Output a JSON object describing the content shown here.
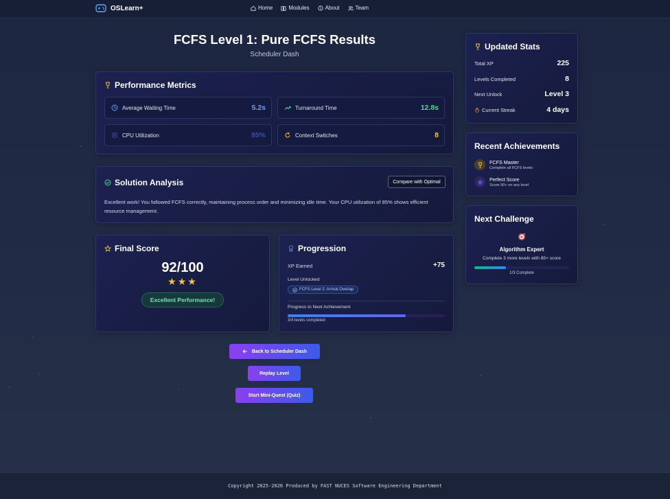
{
  "nav": {
    "brand": "OSLearn+",
    "links": [
      "Home",
      "Modules",
      "About",
      "Team"
    ]
  },
  "page": {
    "title": "FCFS Level 1: Pure FCFS Results",
    "subtitle": "Scheduler Dash"
  },
  "metrics": {
    "title": "Performance Metrics",
    "items": [
      {
        "label": "Average Waiting Time",
        "value": "5.2s",
        "color": "#60a5fa",
        "icon": "clock-icon"
      },
      {
        "label": "Turnaround Time",
        "value": "12.8s",
        "color": "#4ade80",
        "icon": "trending-up-icon"
      },
      {
        "label": "CPU Utilization",
        "value": "85%",
        "color": "#3b4fa0",
        "icon": "cpu-icon"
      },
      {
        "label": "Context Switches",
        "value": "8",
        "color": "#facc15",
        "icon": "rotate-icon"
      }
    ]
  },
  "analysis": {
    "title": "Solution Analysis",
    "compare_label": "Compare with Optimal",
    "text": "Excellent work! You followed FCFS correctly, maintaining process order and minimizing idle time. Your CPU utilization of 85% shows efficient resource management."
  },
  "final_score": {
    "title": "Final Score",
    "score": "92/100",
    "stars": "★★★",
    "star_count": 3,
    "badge": "Excellent Performance!"
  },
  "progression": {
    "title": "Progression",
    "xp_label": "XP Earned",
    "xp_value": "+75",
    "unlocked_label": "Level Unlocked",
    "unlocked_pill": "FCFS Level 2: Arrival Overlap",
    "next_label": "Progress to Next Achievement",
    "next_progress": 0.75,
    "next_caption": "3/4 levels completed"
  },
  "buttons": {
    "back": "Back to Scheduler Dash",
    "replay": "Replay Level",
    "quiz": "Start Mini-Quest (Quiz)"
  },
  "stats": {
    "title": "Updated Stats",
    "rows": [
      {
        "label": "Total XP",
        "value": "225"
      },
      {
        "label": "Levels Completed",
        "value": "8"
      },
      {
        "label": "Next Unlock",
        "value": "Level 3"
      },
      {
        "label": "Current Streak",
        "value": "4 days"
      }
    ]
  },
  "achievements": {
    "title": "Recent Achievements",
    "items": [
      {
        "title": "FCFS Master",
        "desc": "Complete all FCFS levels",
        "icon": "trophy-icon",
        "color": "#f3c53a"
      },
      {
        "title": "Perfect Score",
        "desc": "Score 90+ on any level",
        "icon": "star-icon",
        "color": "#7c5cf0"
      }
    ]
  },
  "challenge": {
    "title": "Next Challenge",
    "icon": "target-icon",
    "name": "Algorithm Expert",
    "desc": "Complete 3 more levels with 85+ score",
    "progress": 0.33,
    "caption": "1/3 Complete"
  },
  "footer": {
    "text": "Copyright 2025-2026 Produced by FAST NUCES Software Engineering Department"
  }
}
